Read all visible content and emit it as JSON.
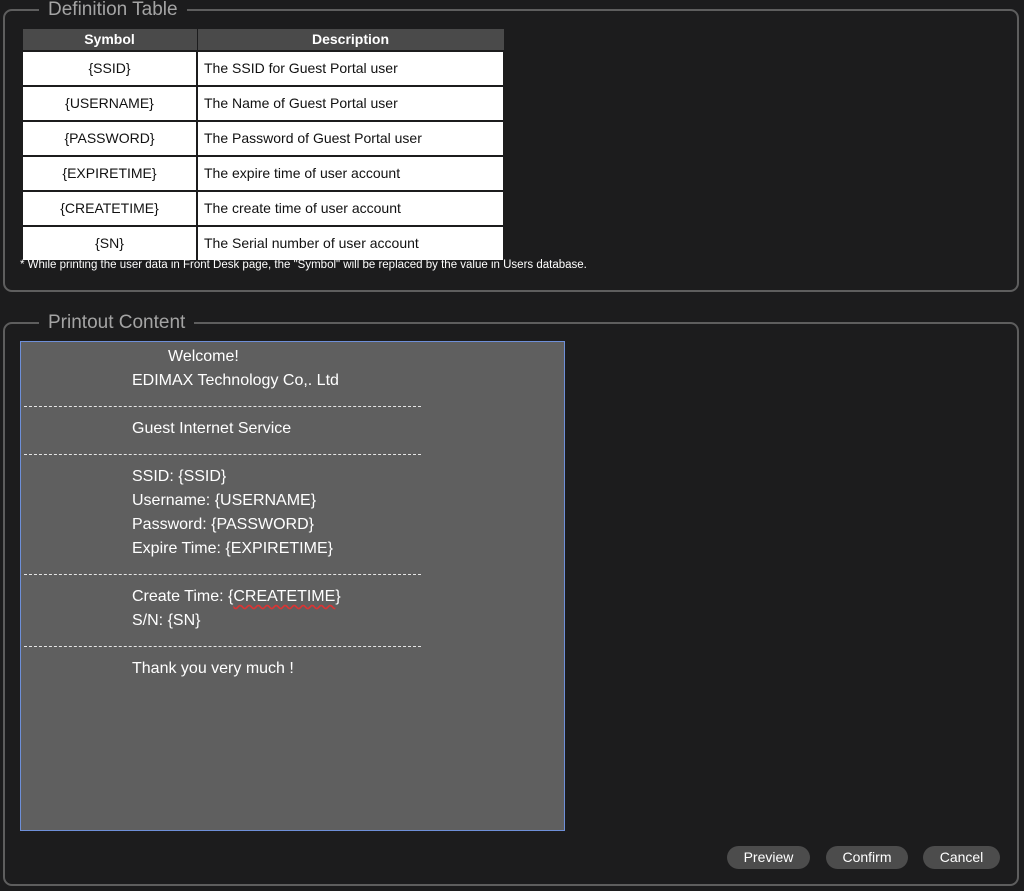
{
  "definition": {
    "legend": "Definition Table",
    "columns": {
      "symbol": "Symbol",
      "description": "Description"
    },
    "rows": [
      {
        "symbol": "{SSID}",
        "description": "The SSID for Guest Portal user"
      },
      {
        "symbol": "{USERNAME}",
        "description": "The Name of Guest Portal user"
      },
      {
        "symbol": "{PASSWORD}",
        "description": "The Password of Guest Portal user"
      },
      {
        "symbol": "{EXPIRETIME}",
        "description": "The expire time of user account"
      },
      {
        "symbol": "{CREATETIME}",
        "description": "The create time of user account"
      },
      {
        "symbol": "{SN}",
        "description": "The Serial number of user account"
      }
    ],
    "footnote": "* While printing the user data in Front Desk page, the \"Symbol\" will be replaced by the value in Users database."
  },
  "printout": {
    "legend": "Printout Content",
    "welcome": "Welcome!",
    "company": "EDIMAX Technology Co,. Ltd",
    "separator": "----------------------------------------------------------------------------------------------------",
    "service": "Guest Internet Service",
    "ssid": "SSID: {SSID}",
    "username": "Username: {USERNAME}",
    "password": "Password: {PASSWORD}",
    "expire": "Expire Time: {EXPIRETIME}",
    "create_prefix": "Create Time: {",
    "create_symbol": "CREATETIME",
    "create_suffix": "}",
    "sn": "S/N: {SN}",
    "thanks": "Thank you very much !"
  },
  "buttons": {
    "preview": "Preview",
    "confirm": "Confirm",
    "cancel": "Cancel"
  }
}
